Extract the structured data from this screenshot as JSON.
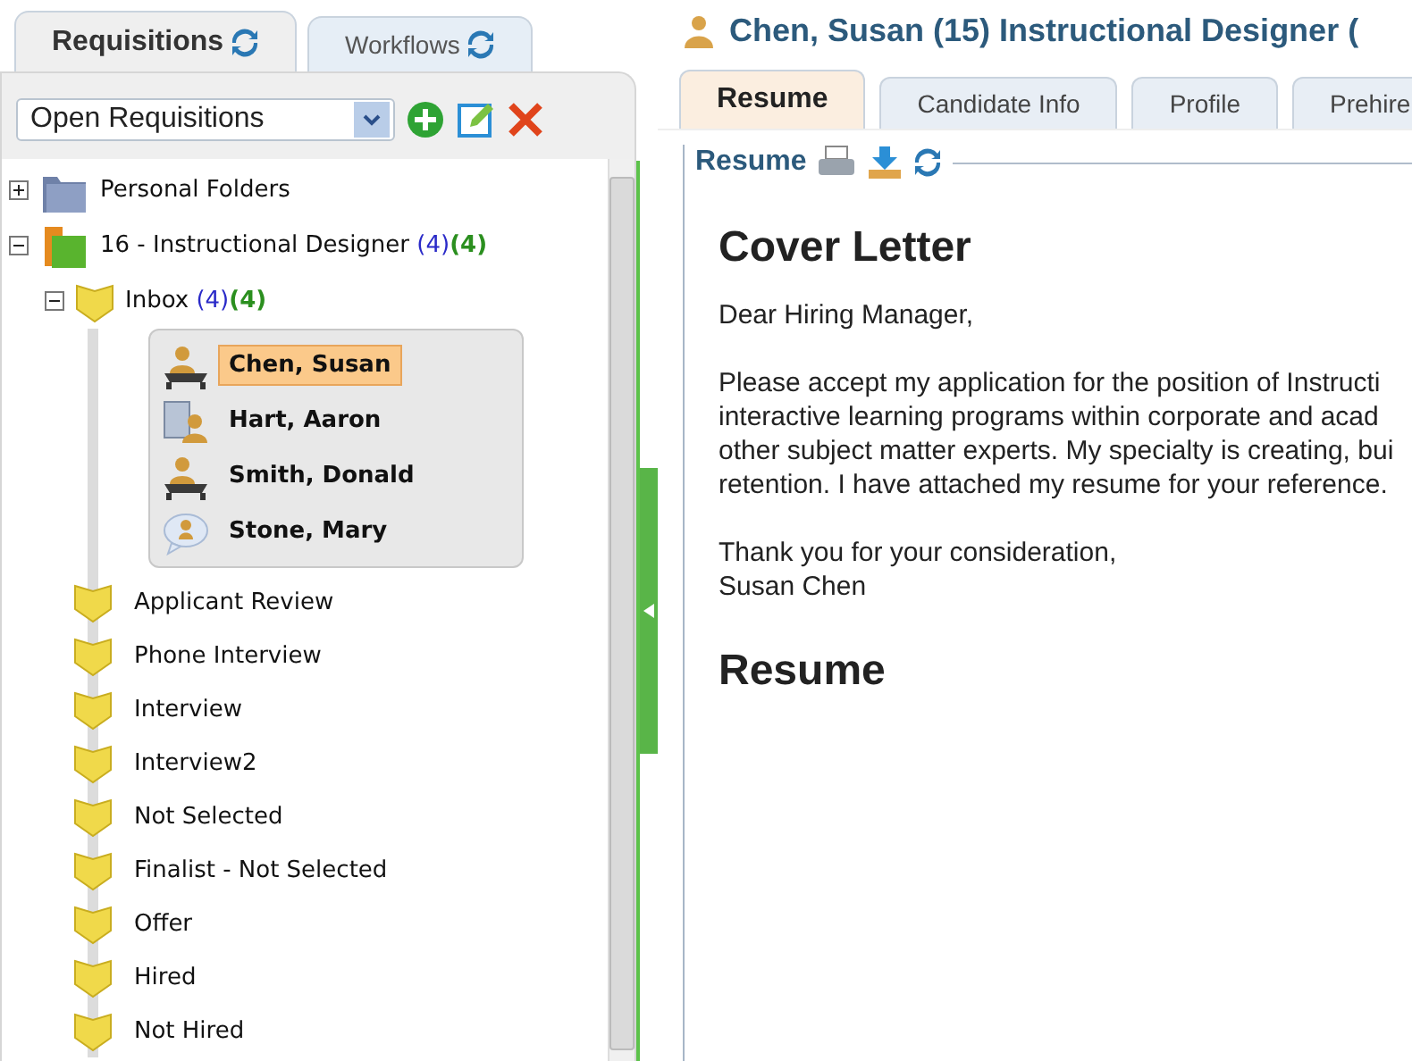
{
  "left_tabs": [
    {
      "label": "Requisitions",
      "selected": true
    },
    {
      "label": "Workflows",
      "selected": false
    }
  ],
  "filter": {
    "value": "Open Requisitions"
  },
  "tree": [
    {
      "label": "Personal Folders",
      "kind": "folder",
      "expanded": false
    },
    {
      "label": "16 - Instructional Designer",
      "kind": "requisition",
      "expanded": true,
      "count": "(4)",
      "new_count": "(4)"
    }
  ],
  "inbox": {
    "label": "Inbox",
    "expanded": true,
    "count": "(4)",
    "new_count": "(4)"
  },
  "candidates": [
    {
      "name": "Chen, Susan",
      "kind": "person",
      "selected": true
    },
    {
      "name": "Hart, Aaron",
      "kind": "company",
      "selected": false
    },
    {
      "name": "Smith, Donald",
      "kind": "person",
      "selected": false
    },
    {
      "name": "Stone, Mary",
      "kind": "bubble",
      "selected": false
    }
  ],
  "stages": [
    "Applicant Review",
    "Phone Interview",
    "Interview",
    "Interview2",
    "Not Selected",
    "Finalist - Not Selected",
    "Offer",
    "Hired",
    "Not Hired"
  ],
  "header": {
    "title": "Chen, Susan (15) Instructional Designer ("
  },
  "tabs": [
    {
      "label": "Resume",
      "selected": true
    },
    {
      "label": "Candidate Info",
      "selected": false
    },
    {
      "label": "Profile",
      "selected": false
    },
    {
      "label": "Prehire",
      "selected": false
    }
  ],
  "section": {
    "title": "Resume"
  },
  "document": {
    "heading": "Cover Letter",
    "salutation": "Dear Hiring Manager,",
    "paragraph_lines": [
      "Please accept my application for the position of Instructi",
      "interactive learning programs within corporate and acad",
      "other subject matter experts. My specialty is creating, bui",
      "retention. I have attached my resume for your reference."
    ],
    "closing": "Thank you for your consideration,",
    "signature": "Susan Chen",
    "second_heading": "Resume"
  }
}
